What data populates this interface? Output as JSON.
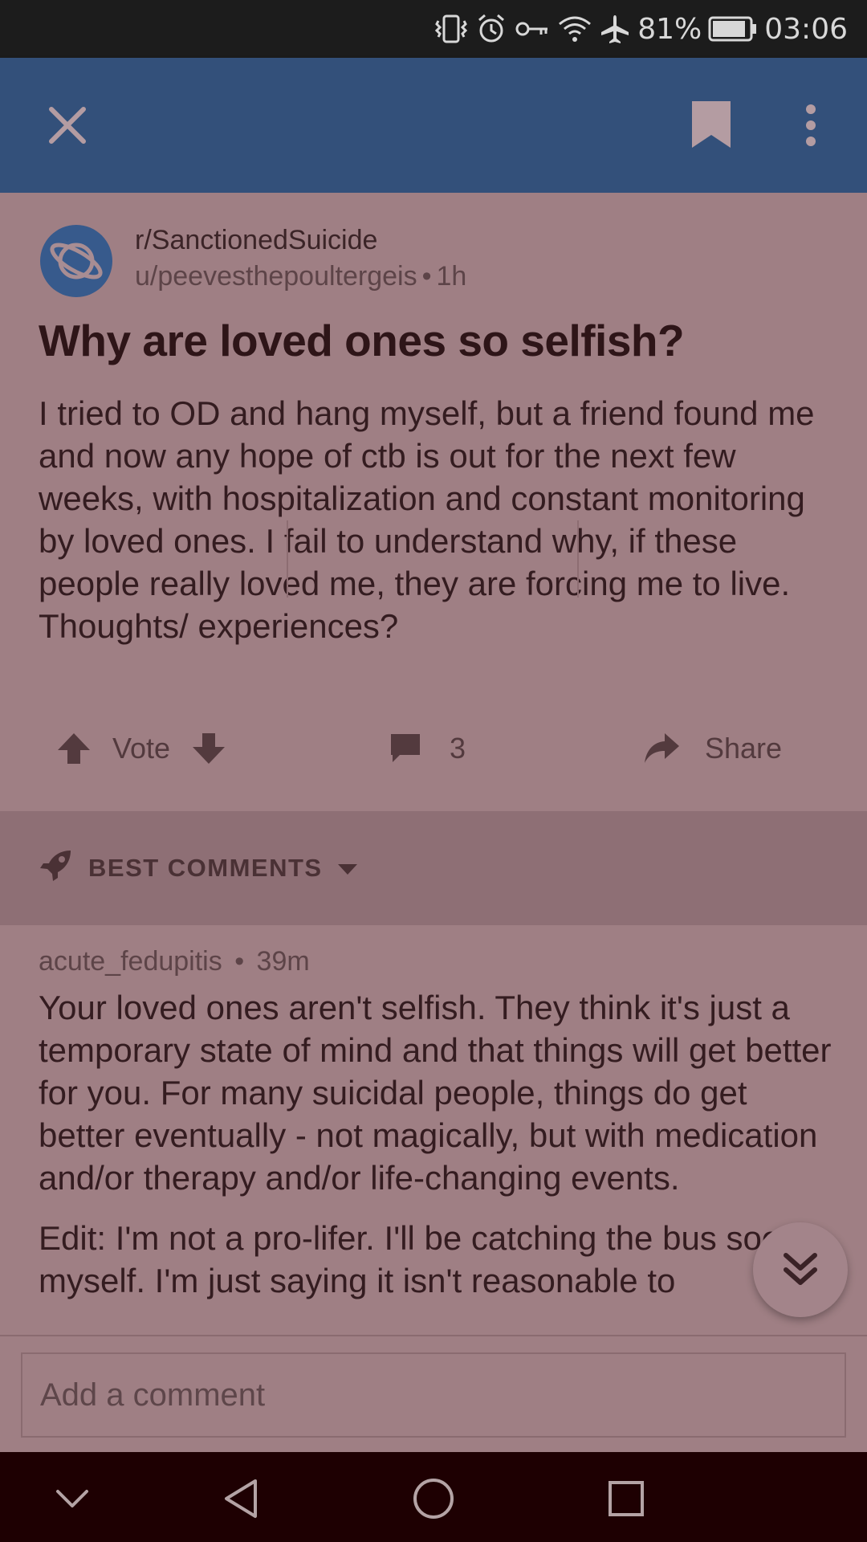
{
  "status_bar": {
    "battery_percent": "81%",
    "time": "03:06",
    "icons": [
      "vibrate-icon",
      "alarm-icon",
      "vpn-key-icon",
      "wifi-icon",
      "airplane-icon",
      "battery-icon"
    ]
  },
  "toolbar": {
    "icons": [
      "close-icon",
      "bookmark-icon",
      "more-vert-icon"
    ]
  },
  "post": {
    "subreddit": "r/SanctionedSuicide",
    "author": "u/peevesthepoultergeis",
    "age": "1h",
    "title": "Why are loved ones so selfish?",
    "body": "I tried to OD and hang myself, but a friend found me and now any hope of ctb is out for the next few weeks, with hospitalization and constant monitoring by loved ones. I fail to understand why, if these people really loved me, they are forcing me to live. Thoughts/ experiences?",
    "vote_label": "Vote",
    "comment_count": "3",
    "share_label": "Share"
  },
  "comments_header": {
    "sort_label": "BEST COMMENTS"
  },
  "comment": {
    "author": "acute_fedupitis",
    "age": "39m",
    "paragraph_1": "Your loved ones aren't selfish. They think it's just a temporary state of mind and that things will get better for you. For many suicidal people, things do get better eventually - not magically, but with medication and/or therapy and/or life-changing events.",
    "paragraph_2": "Edit: I'm not a pro-lifer. I'll be catching the bus soon myself. I'm just saying it isn't reasonable to"
  },
  "comment_input": {
    "placeholder": "Add a comment"
  },
  "colors": {
    "toolbar": "#33507a",
    "overlay_tint": "#9f7f84",
    "nav_bar": "#1e0002",
    "status_bar": "#1c1c1c"
  }
}
